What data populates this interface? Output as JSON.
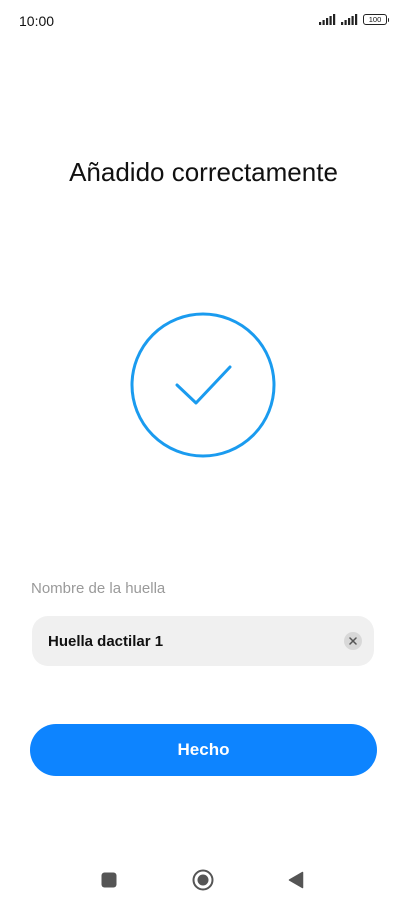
{
  "status_bar": {
    "time": "10:00",
    "battery_level": "100",
    "icons": [
      "signal-icon",
      "signal-icon",
      "battery-icon"
    ]
  },
  "main": {
    "title": "Añadido correctamente",
    "success_icon": "check-circle-icon",
    "field_label": "Nombre de la huella",
    "fingerprint_name_value": "Huella dactilar 1",
    "clear_icon": "clear-icon",
    "done_label": "Hecho"
  },
  "nav_bar": {
    "icons": [
      "recents-square-icon",
      "home-circle-icon",
      "back-triangle-icon"
    ]
  },
  "colors": {
    "accent": "#0d84ff",
    "success_ring": "#1a9bef",
    "input_bg": "#f0f0f0",
    "label_gray": "#9a9a9a"
  }
}
